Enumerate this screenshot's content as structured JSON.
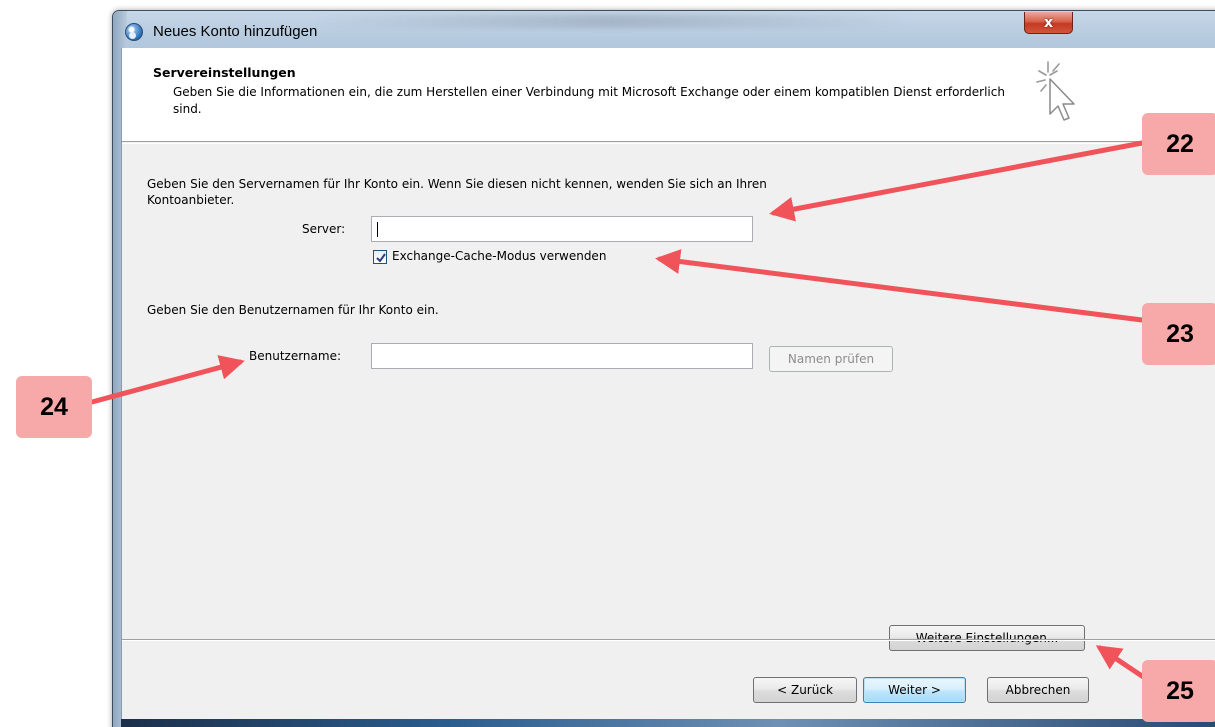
{
  "window": {
    "title": "Neues Konto hinzufügen",
    "close_glyph": "x"
  },
  "header": {
    "title": "Servereinstellungen",
    "subtitle": "Geben Sie die Informationen ein, die zum Herstellen einer Verbindung mit Microsoft Exchange oder einem kompatiblen Dienst erforderlich sind.",
    "icon": "wizard-cursor-icon"
  },
  "server_section": {
    "intro": "Geben Sie den Servernamen für Ihr Konto ein. Wenn Sie diesen nicht kennen, wenden Sie sich an Ihren Kontoanbieter.",
    "server_label": "Server:",
    "server_value": "",
    "cache_checkbox_label": "Exchange-Cache-Modus verwenden",
    "cache_checked": true
  },
  "user_section": {
    "intro": "Geben Sie den Benutzernamen für Ihr Konto ein.",
    "username_label": "Benutzername:",
    "username_value": "",
    "check_names_button": "Namen prüfen"
  },
  "more_settings_button": "Weitere Einstellungen...",
  "footer": {
    "back_button": "< Zurück",
    "next_button": "Weiter >",
    "cancel_button": "Abbrechen"
  },
  "annotations": [
    "22",
    "23",
    "24",
    "25"
  ],
  "colors": {
    "badge": "#f7a8a8",
    "arrow": "#f0545a",
    "close_button": "#c23a23"
  }
}
